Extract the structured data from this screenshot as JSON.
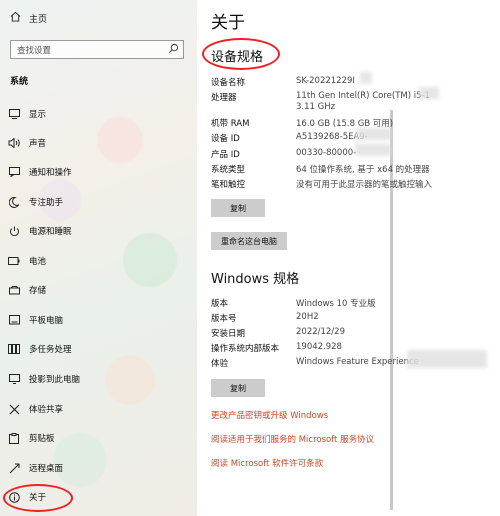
{
  "sidebar": {
    "home": "主页",
    "search_placeholder": "查找设置",
    "section": "系统",
    "items": [
      {
        "label": "显示",
        "icon": "display-icon"
      },
      {
        "label": "声音",
        "icon": "sound-icon"
      },
      {
        "label": "通知和操作",
        "icon": "notification-icon"
      },
      {
        "label": "专注助手",
        "icon": "focus-icon"
      },
      {
        "label": "电源和睡眠",
        "icon": "power-icon"
      },
      {
        "label": "电池",
        "icon": "battery-icon"
      },
      {
        "label": "存储",
        "icon": "storage-icon"
      },
      {
        "label": "平板电脑",
        "icon": "tablet-icon"
      },
      {
        "label": "多任务处理",
        "icon": "multitask-icon"
      },
      {
        "label": "投影到此电脑",
        "icon": "project-icon"
      },
      {
        "label": "体验共享",
        "icon": "share-icon"
      },
      {
        "label": "剪贴板",
        "icon": "clipboard-icon"
      },
      {
        "label": "远程桌面",
        "icon": "remote-icon"
      },
      {
        "label": "关于",
        "icon": "info-icon"
      }
    ]
  },
  "main": {
    "title": "关于",
    "device_title": "设备规格",
    "device_rows": [
      {
        "k": "设备名称",
        "v": "SK-20221229I"
      },
      {
        "k": "处理器",
        "v": "11th Gen Intel(R) Core(TM) i5-1"
      },
      {
        "k": "",
        "v": "3.11 GHz"
      },
      {
        "k": "机带 RAM",
        "v": "16.0 GB (15.8 GB 可用)"
      },
      {
        "k": "设备 ID",
        "v": "A5139268-5EA9-"
      },
      {
        "k": "产品 ID",
        "v": "00330-80000-"
      },
      {
        "k": "系统类型",
        "v": "64 位操作系统, 基于 x64 的处理器"
      },
      {
        "k": "笔和触控",
        "v": "没有可用于此显示器的笔或触控输入"
      }
    ],
    "copy_btn": "复制",
    "rename_btn": "重命名这台电脑",
    "windows_title": "Windows 规格",
    "windows_rows": [
      {
        "k": "版本",
        "v": "Windows 10 专业版"
      },
      {
        "k": "版本号",
        "v": "20H2"
      },
      {
        "k": "安装日期",
        "v": "2022/12/29"
      },
      {
        "k": "操作系统内部版本",
        "v": "19042.928"
      },
      {
        "k": "体验",
        "v": "Windows Feature Experience"
      }
    ],
    "copy_btn2": "复制",
    "links": [
      "更改产品密钥或升级 Windows",
      "阅读适用于我们服务的 Microsoft 服务协议",
      "阅读 Microsoft 软件许可条款"
    ]
  }
}
